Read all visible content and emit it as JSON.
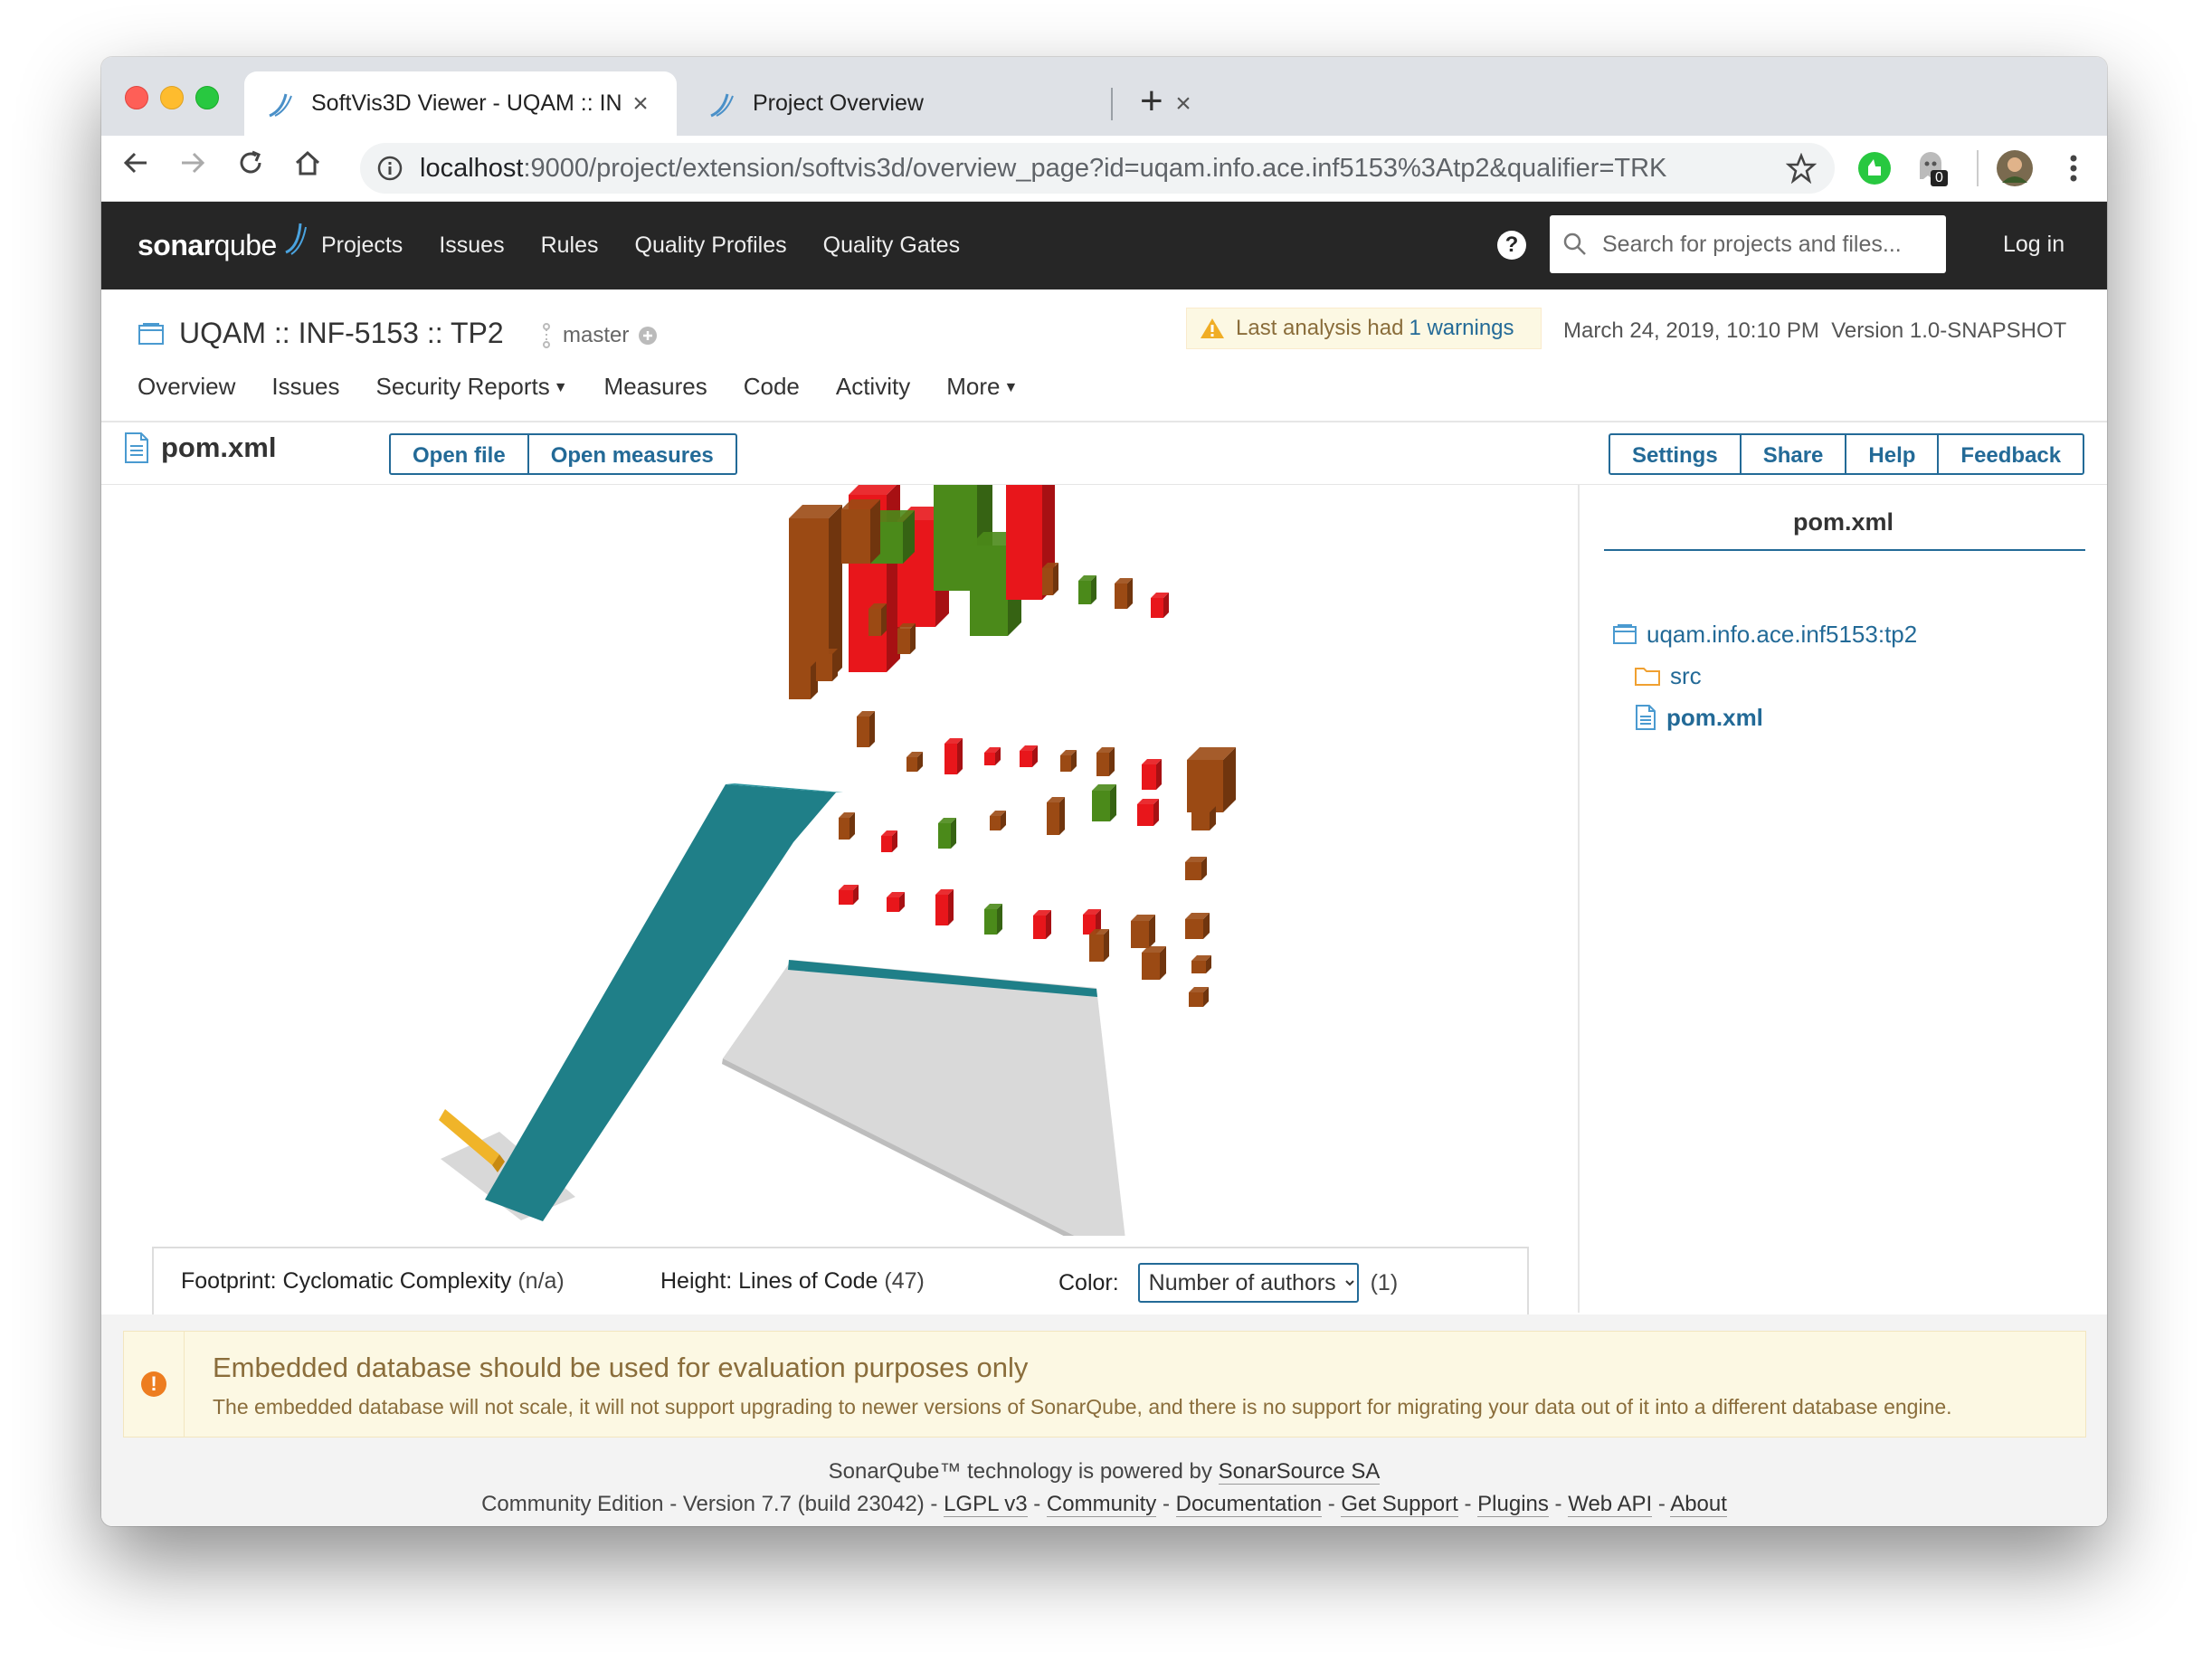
{
  "browser": {
    "tabs": [
      {
        "title": "SoftVis3D Viewer - UQAM :: IN",
        "close": "×"
      },
      {
        "title": "Project Overview",
        "close": "×"
      }
    ],
    "new_tab": "+",
    "url_host": "localhost",
    "url_rest": ":9000/project/extension/softvis3d/overview_page?id=uqam.info.ace.inf5153%3Atp2&qualifier=TRK",
    "extension_badge": "0"
  },
  "sonarqube": {
    "logo_plain": "sonar",
    "logo_bold": "qube",
    "nav": [
      "Projects",
      "Issues",
      "Rules",
      "Quality Profiles",
      "Quality Gates"
    ],
    "search_placeholder": "Search for projects and files...",
    "login": "Log in"
  },
  "project": {
    "name": "UQAM :: INF-5153 :: TP2",
    "branch": "master",
    "warning_prefix": "Last analysis had",
    "warning_link": "1 warnings",
    "analysis_date": "March 24, 2019, 10:10 PM",
    "version": "Version 1.0-SNAPSHOT",
    "tabs": [
      "Overview",
      "Issues",
      "Security Reports",
      "Measures",
      "Code",
      "Activity",
      "More"
    ]
  },
  "viewer": {
    "file_title": "pom.xml",
    "file_buttons": [
      "Open file",
      "Open measures"
    ],
    "right_buttons": [
      "Settings",
      "Share",
      "Help",
      "Feedback"
    ],
    "legend": {
      "footprint_label": "Footprint: Cyclomatic Complexity",
      "footprint_value": "(n/a)",
      "height_label": "Height: Lines of Code",
      "height_value": "(47)",
      "color_label": "Color:",
      "color_selected": "Number of authors",
      "color_value": "(1)"
    },
    "colors": {
      "red": "#e8161b",
      "green": "#4b8a1a",
      "brown": "#9b4a14",
      "teal": "#1f7f88",
      "yellow": "#f0b429"
    }
  },
  "side_panel": {
    "title": "pom.xml",
    "tree": [
      {
        "label": "uqam.info.ace.inf5153:tp2",
        "icon": "project-icon"
      },
      {
        "label": "src",
        "icon": "folder-icon"
      },
      {
        "label": "pom.xml",
        "icon": "file-icon"
      }
    ]
  },
  "alert": {
    "title": "Embedded database should be used for evaluation purposes only",
    "body": "The embedded database will not scale, it will not support upgrading to newer versions of SonarQube, and there is no support for migrating your data out of it into a different database engine."
  },
  "footer": {
    "line1_text": "SonarQube™ technology is powered by",
    "line1_link": "SonarSource SA",
    "edition": "Community Edition",
    "version": "Version 7.7 (build 23042)",
    "links": [
      "LGPL v3",
      "Community",
      "Documentation",
      "Get Support",
      "Plugins",
      "Web API",
      "About"
    ],
    "sep": "-"
  }
}
